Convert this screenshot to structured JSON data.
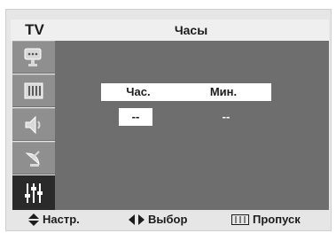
{
  "header": {
    "source_label": "TV",
    "title": "Часы"
  },
  "sidebar": {
    "items": [
      {
        "name": "picture-icon",
        "active": false
      },
      {
        "name": "channel-grid-icon",
        "active": false
      },
      {
        "name": "speaker-icon",
        "active": false
      },
      {
        "name": "satellite-dish-icon",
        "active": false
      },
      {
        "name": "settings-sliders-icon",
        "active": true
      }
    ]
  },
  "clock": {
    "hours_label": "Час.",
    "minutes_label": "Мин.",
    "hours_value": "--",
    "minutes_value": "--"
  },
  "footer": {
    "adjust_label": "Настр.",
    "select_label": "Выбор",
    "skip_label": "Пропуск"
  },
  "colors": {
    "panel": "#6e6e6e",
    "sidebar": "#8f8f8f",
    "active": "#2a2a2a",
    "frame": "#e6e6e6"
  }
}
